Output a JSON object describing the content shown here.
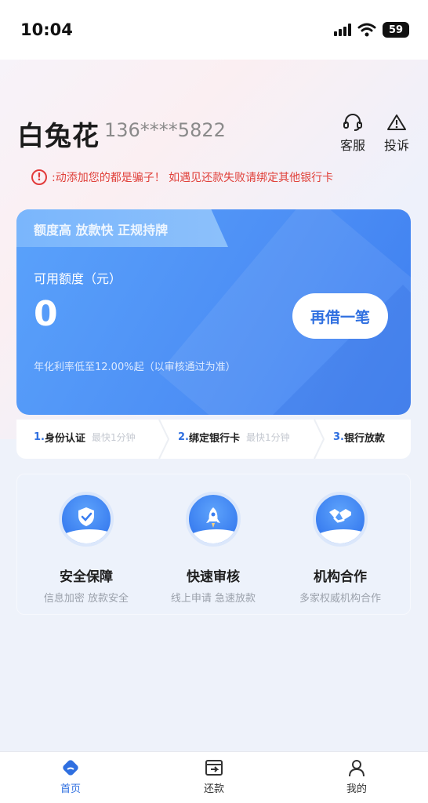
{
  "status_bar": {
    "time": "10:04",
    "battery": "59"
  },
  "header": {
    "brand": "白兔花",
    "phone": "136****5822",
    "service_label": "客服",
    "complaint_label": "投诉"
  },
  "warning": {
    "text": ":动添加您的都是骗子！ 如遇见还款失败请绑定其他银行卡"
  },
  "credit_card": {
    "tagline": "额度高 放款快 正规持牌",
    "available_label": "可用额度（元）",
    "amount": "0",
    "rate_note": "年化利率低至12.00%起（以审核通过为准）",
    "borrow_button": "再借一笔"
  },
  "steps": [
    {
      "num": "1.",
      "name": "身份认证",
      "hint": "最快1分钟"
    },
    {
      "num": "2.",
      "name": "绑定银行卡",
      "hint": "最快1分钟"
    },
    {
      "num": "3.",
      "name": "银行放款",
      "hint": ""
    }
  ],
  "features": [
    {
      "title": "安全保障",
      "subtitle": "信息加密 放款安全",
      "icon": "shield-icon"
    },
    {
      "title": "快速审核",
      "subtitle": "线上申请 急速放款",
      "icon": "rocket-icon"
    },
    {
      "title": "机构合作",
      "subtitle": "多家权威机构合作",
      "icon": "handshake-icon"
    }
  ],
  "tabbar": [
    {
      "label": "首页",
      "icon": "home-icon",
      "active": true
    },
    {
      "label": "还款",
      "icon": "repay-icon",
      "active": false
    },
    {
      "label": "我的",
      "icon": "user-icon",
      "active": false
    }
  ],
  "colors": {
    "accent": "#2f6fe0",
    "warning": "#e0403a",
    "card": "#4d8ff5"
  }
}
